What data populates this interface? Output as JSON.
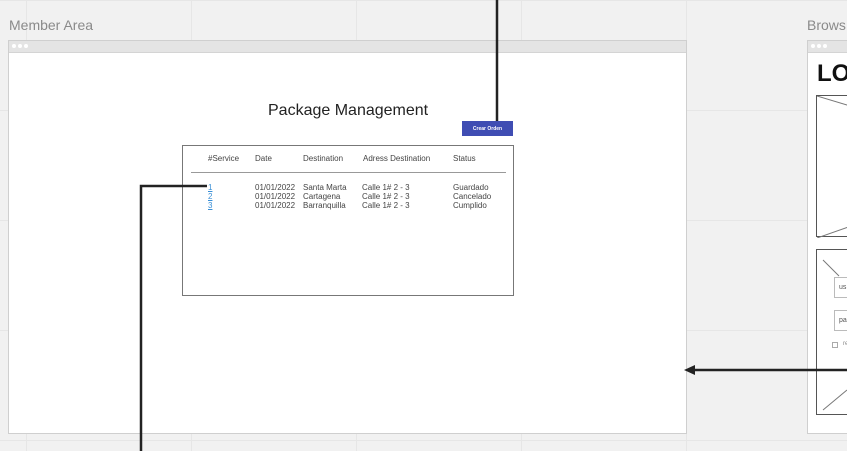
{
  "frames": {
    "member_area_label": "Member Area",
    "browser_label": "Brows"
  },
  "member_area": {
    "page_title": "Package Management",
    "create_button_label": "Crear Orden",
    "table": {
      "columns": [
        "#Service",
        "Date",
        "Destination",
        "Adress Destination",
        "Status"
      ],
      "rows": [
        [
          "1",
          "01/01/2022",
          "Santa Marta",
          "Calle 1# 2 - 3",
          "Guardado"
        ],
        [
          "2",
          "01/01/2022",
          "Cartagena",
          "Calle 1# 2 - 3",
          "Cancelado"
        ],
        [
          "3",
          "01/01/2022",
          "Barranquilla",
          "Calle 1# 2 - 3",
          "Cumplido"
        ]
      ]
    }
  },
  "browser_frame": {
    "title_text": "LO",
    "input1_text": "us",
    "input2_text": "pa",
    "checkbox_label": "re"
  },
  "colors": {
    "button": "#3f4db3",
    "link": "#3a8fd6",
    "connector": "#222222"
  }
}
